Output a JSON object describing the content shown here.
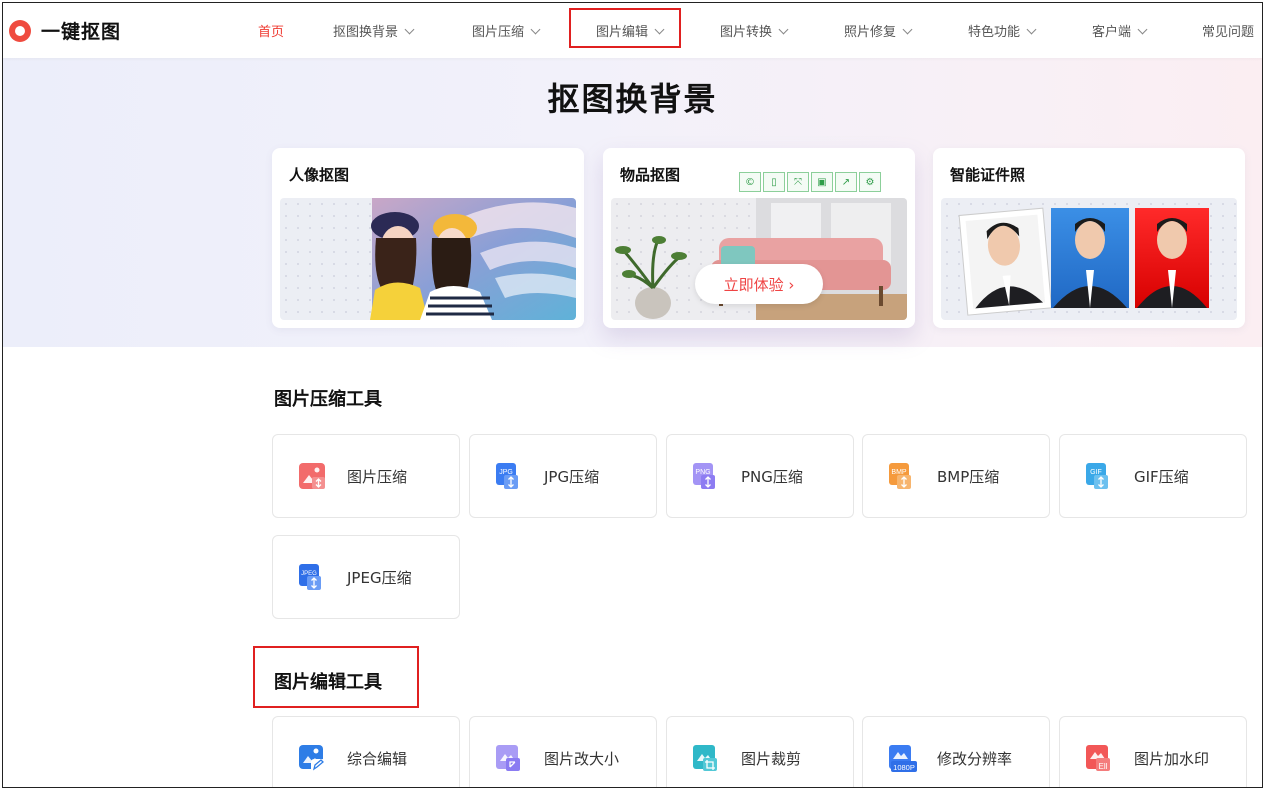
{
  "brand": {
    "name": "一键抠图",
    "accent": "#ef3b32"
  },
  "nav": [
    {
      "label": "首页",
      "active": true,
      "dropdown": false
    },
    {
      "label": "抠图换背景",
      "dropdown": true
    },
    {
      "label": "图片压缩",
      "dropdown": true
    },
    {
      "label": "图片编辑",
      "dropdown": true,
      "highlighted": true
    },
    {
      "label": "图片转换",
      "dropdown": true
    },
    {
      "label": "照片修复",
      "dropdown": true
    },
    {
      "label": "特色功能",
      "dropdown": true
    },
    {
      "label": "客户端",
      "dropdown": true
    },
    {
      "label": "常见问题",
      "dropdown": false
    }
  ],
  "hero": {
    "title": "抠图换背景",
    "cards": [
      {
        "title": "人像抠图"
      },
      {
        "title": "物品抠图",
        "button": "立即体验 ›"
      },
      {
        "title": "智能证件照"
      }
    ],
    "toolbar_icons": [
      "refresh-icon",
      "copy-icon",
      "expand-icon",
      "save-icon",
      "share-icon",
      "settings-icon"
    ]
  },
  "compress": {
    "title": "图片压缩工具",
    "tools": [
      {
        "label": "图片压缩",
        "icon": "image-compress-icon",
        "badge": "",
        "color": "#f26b6b"
      },
      {
        "label": "JPG压缩",
        "icon": "jpg-icon",
        "badge": "JPG",
        "color": "#3b7cf2"
      },
      {
        "label": "PNG压缩",
        "icon": "png-icon",
        "badge": "PNG",
        "color": "#8d7cf2"
      },
      {
        "label": "BMP压缩",
        "icon": "bmp-icon",
        "badge": "BMP",
        "color": "#f59a3c"
      },
      {
        "label": "GIF压缩",
        "icon": "gif-icon",
        "badge": "GIF",
        "color": "#3aa8e8"
      },
      {
        "label": "JPEG压缩",
        "icon": "jpeg-icon",
        "badge": "JPEG",
        "color": "#2f6fe8"
      }
    ]
  },
  "edit": {
    "title": "图片编辑工具",
    "tools": [
      {
        "label": "综合编辑",
        "icon": "edit-icon",
        "badge": "",
        "color": "#2e7de6"
      },
      {
        "label": "图片改大小",
        "icon": "resize-icon",
        "badge": "",
        "color": "#8b7cf2"
      },
      {
        "label": "图片裁剪",
        "icon": "crop-icon",
        "badge": "",
        "color": "#2fb8c8"
      },
      {
        "label": "修改分辨率",
        "icon": "resolution-icon",
        "badge": "1080P",
        "color": "#2f6fe8"
      },
      {
        "label": "图片加水印",
        "icon": "watermark-icon",
        "badge": "Ell",
        "color": "#f25757"
      }
    ]
  }
}
